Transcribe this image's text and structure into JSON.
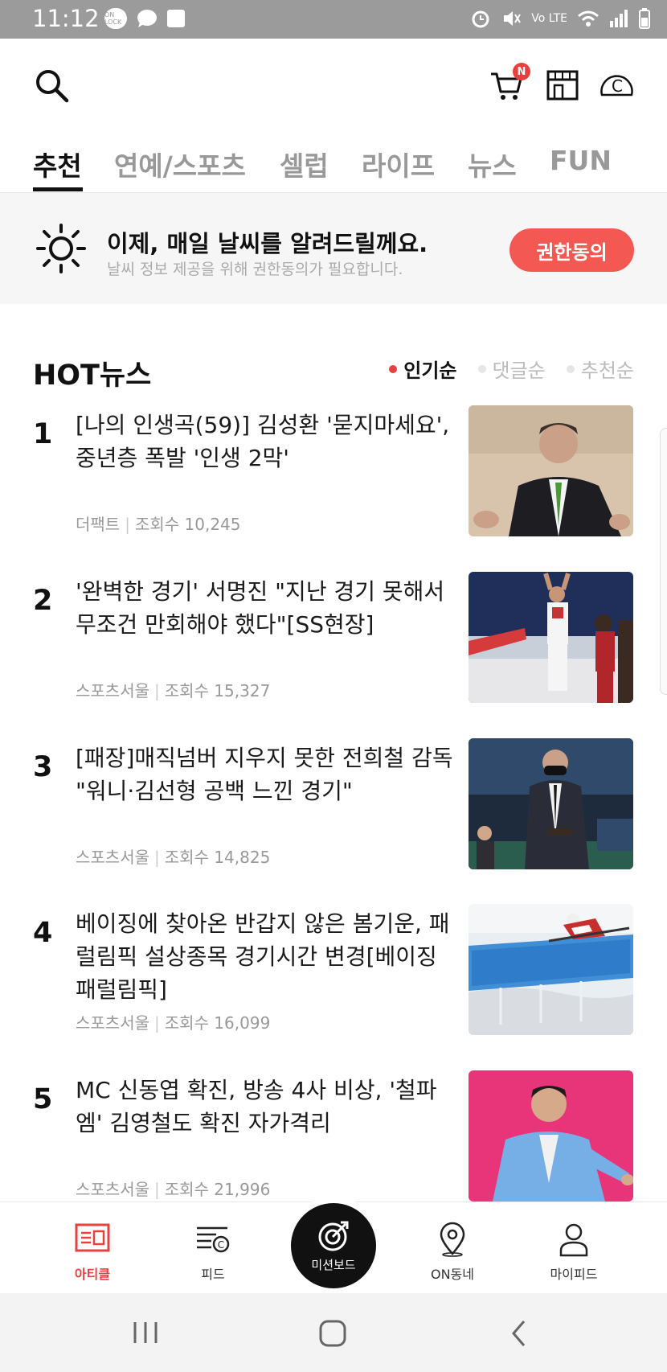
{
  "status_bar": {
    "time": "11:12",
    "network": "Vo LTE",
    "lock_badge": "ON LOCK"
  },
  "header": {
    "cart_badge": "N"
  },
  "tabs": [
    {
      "label": "추천",
      "active": true
    },
    {
      "label": "연예/스포츠",
      "active": false
    },
    {
      "label": "셀럽",
      "active": false
    },
    {
      "label": "라이프",
      "active": false
    },
    {
      "label": "뉴스",
      "active": false
    },
    {
      "label": "FUN",
      "active": false
    }
  ],
  "weather_banner": {
    "title": "이제, 매일 날씨를 알려드릴께요.",
    "subtitle": "날씨 정보 제공을 위해 권한동의가 필요합니다.",
    "button_label": "권한동의"
  },
  "hot_news": {
    "title": "HOT뉴스",
    "sort_options": [
      {
        "label": "인기순",
        "active": true
      },
      {
        "label": "댓글순",
        "active": false
      },
      {
        "label": "추천순",
        "active": false
      }
    ],
    "items": [
      {
        "rank": "1",
        "headline": "[나의 인생곡(59)] 김성환 '묻지마세요', 중년층 폭발 '인생 2막'",
        "source": "더팩트",
        "views": "조회수 10,245"
      },
      {
        "rank": "2",
        "headline": "'완벽한 경기' 서명진 \"지난 경기 못해서 무조건 만회해야 했다\"[SS현장]",
        "source": "스포츠서울",
        "views": "조회수 15,327"
      },
      {
        "rank": "3",
        "headline": "[패장]매직넘버 지우지 못한 전희철 감독 \"워니·김선형 공백 느낀 경기\"",
        "source": "스포츠서울",
        "views": "조회수 14,825"
      },
      {
        "rank": "4",
        "headline": "베이징에 찾아온 반갑지 않은 봄기운, 패럴림픽 설상종목 경기시간 변경[베이징 패럴림픽]",
        "source": "스포츠서울",
        "views": "조회수 16,099"
      },
      {
        "rank": "5",
        "headline": "MC 신동엽 확진, 방송 4사 비상, '철파엠' 김영철도 확진 자가격리",
        "source": "스포츠서울",
        "views": "조회수 21,996"
      }
    ]
  },
  "bottom_nav": {
    "items": [
      {
        "label": "아티클",
        "active": true
      },
      {
        "label": "피드",
        "active": false
      },
      {
        "label": "미션보드",
        "active": false
      },
      {
        "label": "ON동네",
        "active": false
      },
      {
        "label": "마이피드",
        "active": false
      }
    ]
  },
  "colors": {
    "accent": "#e8403d",
    "consent_button": "#f45853",
    "banner_bg": "#f6f6f6"
  }
}
